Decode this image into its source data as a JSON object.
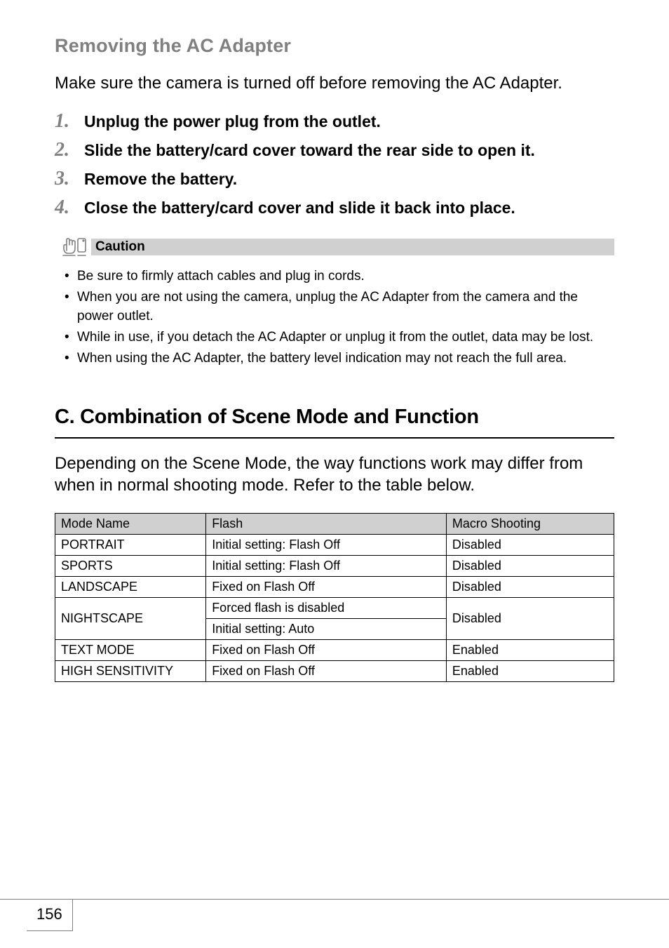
{
  "sub_heading": "Removing the AC Adapter",
  "intro": "Make sure the camera is turned off before removing the AC Adapter.",
  "steps": [
    "Unplug the power plug from the outlet.",
    "Slide the battery/card cover toward the rear side to open it.",
    "Remove the battery.",
    "Close the battery/card cover and slide it back into place."
  ],
  "caution_label": "Caution",
  "cautions": [
    "Be sure to firmly attach cables and plug in cords.",
    "When you are not using the camera, unplug the AC Adapter from the camera and the power outlet.",
    "While in use, if you detach the AC Adapter or unplug it from the outlet, data may be lost.",
    "When using the AC Adapter, the battery level indication may not reach the full area."
  ],
  "main_heading": "C. Combination of Scene Mode and Function",
  "main_intro": "Depending on the Scene Mode, the way functions work may differ from when in normal shooting mode. Refer to the table below.",
  "table": {
    "headers": [
      "Mode Name",
      "Flash",
      "Macro Shooting"
    ],
    "rows": [
      {
        "mode": "PORTRAIT",
        "flash": [
          "Initial setting: Flash Off"
        ],
        "macro": "Disabled"
      },
      {
        "mode": "SPORTS",
        "flash": [
          "Initial setting: Flash Off"
        ],
        "macro": "Disabled"
      },
      {
        "mode": "LANDSCAPE",
        "flash": [
          "Fixed on Flash Off"
        ],
        "macro": "Disabled"
      },
      {
        "mode": "NIGHTSCAPE",
        "flash": [
          "Forced flash is disabled",
          "Initial setting: Auto"
        ],
        "macro": "Disabled"
      },
      {
        "mode": "TEXT MODE",
        "flash": [
          "Fixed on Flash Off"
        ],
        "macro": "Enabled"
      },
      {
        "mode": "HIGH SENSITIVITY",
        "flash": [
          "Fixed on Flash Off"
        ],
        "macro": "Enabled"
      }
    ]
  },
  "page_number": "156"
}
